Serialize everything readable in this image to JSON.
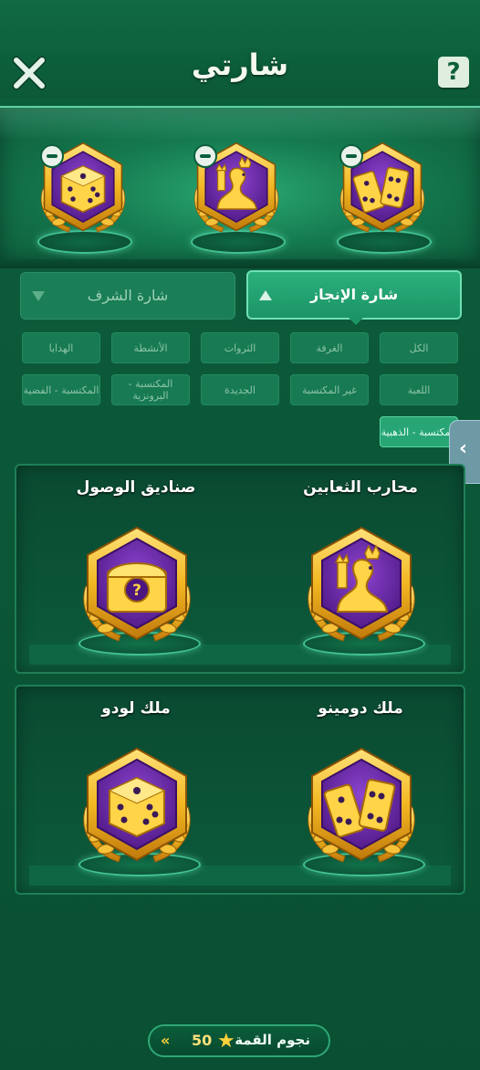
{
  "header": {
    "title": "شارتي",
    "help_label": "?"
  },
  "showcase": {
    "equipped": [
      {
        "icon": "dice-badge-icon",
        "remove_icon": "minus-icon"
      },
      {
        "icon": "snake-king-badge-icon",
        "remove_icon": "minus-icon"
      },
      {
        "icon": "domino-badge-icon",
        "remove_icon": "minus-icon"
      }
    ]
  },
  "tabs": [
    {
      "label": "شارة الإنجاز",
      "active": true
    },
    {
      "label": "شارة الشرف",
      "active": false
    }
  ],
  "filters": [
    {
      "label": "الكل"
    },
    {
      "label": "الغرفة"
    },
    {
      "label": "الثروات"
    },
    {
      "label": "الأنشطة"
    },
    {
      "label": "الهدايا"
    },
    {
      "label": "اللعبة"
    },
    {
      "label": "غير المكتسبة"
    },
    {
      "label": "الجديدة"
    },
    {
      "label": "المكتسبة - البرونزية"
    },
    {
      "label": "المكتسبة - الفضية"
    },
    {
      "label": "المكتسبة - الذهبية",
      "active": true
    }
  ],
  "badges": [
    {
      "title": "محارب الثعابين",
      "icon": "snake-king-badge-icon"
    },
    {
      "title": "صناديق الوصول",
      "icon": "treasure-chest-badge-icon"
    },
    {
      "title": "ملك دومينو",
      "icon": "domino-badge-icon"
    },
    {
      "title": "ملك لودو",
      "icon": "dice-badge-icon"
    }
  ],
  "footer": {
    "label": "نجوم القمة",
    "count": "50",
    "star_icon": "star-icon",
    "arrow_icon": "double-chevron-left-icon"
  },
  "colors": {
    "background": "#0b5838",
    "gold": "#f4c53a",
    "purple": "#6a2aa8",
    "accent": "#2bb07c"
  }
}
